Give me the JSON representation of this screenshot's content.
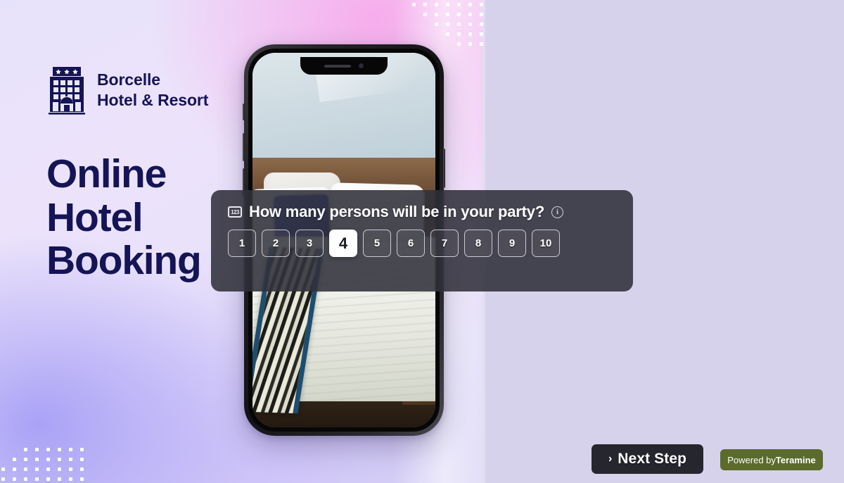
{
  "brand": {
    "logo_icon": "hotel-building-icon",
    "name_line1": "Borcelle",
    "name_line2": "Hotel & Resort",
    "color": "#151455"
  },
  "headline": {
    "line1": "Online",
    "line2": "Hotel",
    "line3": "Booking",
    "color": "#151455"
  },
  "phone_mockup": {
    "screen_content": "hotel-room-photo",
    "notch_icons": [
      "speaker-slot",
      "front-camera-dot"
    ],
    "side_buttons": [
      "silent-switch",
      "volume-up",
      "volume-down",
      "power"
    ]
  },
  "overlay": {
    "prefix_icon": "number-input-123-icon",
    "question": "How many persons will be in your party?",
    "info_icon": "info-circle-icon",
    "options": [
      "1",
      "2",
      "3",
      "4",
      "5",
      "6",
      "7",
      "8",
      "9",
      "10"
    ],
    "selected": "4",
    "panel_color": "#30303a"
  },
  "footer": {
    "next_chevron": "›",
    "next_label": "Next Step",
    "next_color": "#26262e",
    "powered_prefix": "Powered by",
    "powered_brand": "Teramine",
    "powered_color": "#5b6b2c"
  },
  "decor": {
    "top_dots": "triangular-dot-pattern",
    "bottom_dots": "grid-dot-pattern"
  }
}
